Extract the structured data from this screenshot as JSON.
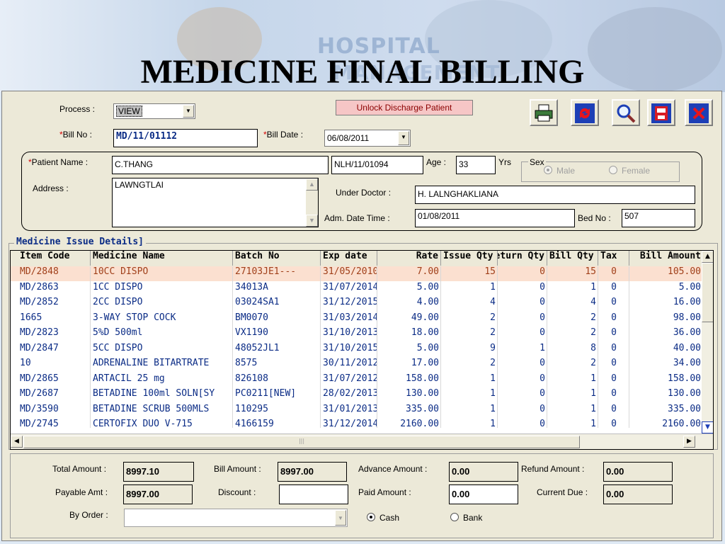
{
  "banner": {
    "title": "MEDICINE FINAL BILLING",
    "watermark_line1": "HOSPITAL",
    "watermark_line2": "MANAGEMENT"
  },
  "form": {
    "process_label": "Process :",
    "process_value": "VIEW",
    "bill_no_label": "Bill No :",
    "bill_no_value": "MD/11/01112",
    "bill_date_label": "Bill Date :",
    "bill_date_value": "06/08/2011",
    "unlock_label": "Unlock Discharge Patient",
    "patient_name_label": "Patient Name :",
    "patient_name_value": "C.THANG",
    "patient_id_value": "NLH/11/01094",
    "age_label": "Age :",
    "age_value": "33",
    "age_unit": "Yrs",
    "sex_label": "Sex",
    "sex_male": "Male",
    "sex_female": "Female",
    "address_label": "Address :",
    "address_value": "LAWNGTLAI",
    "under_doctor_label": "Under Doctor :",
    "under_doctor_value": "H. LALNGHAKLIANA",
    "adm_date_label": "Adm. Date Time :",
    "adm_date_value": "01/08/2011",
    "bed_no_label": "Bed No :",
    "bed_no_value": "507"
  },
  "toolbar": {
    "buttons": [
      "printer-icon",
      "refresh-icon",
      "search-icon",
      "save-icon",
      "close-icon"
    ]
  },
  "grid": {
    "title": "Medicine Issue  Details]",
    "headers": [
      "Item Code",
      "Medicine Name",
      "Batch No",
      "Exp date",
      "Rate",
      "Issue Qty",
      "Return Qty",
      "Bill Qty",
      "Tax",
      "Bill Amount"
    ],
    "rows": [
      [
        "MD/2848",
        "10CC DISPO",
        "27103JE1---",
        "31/05/2010",
        "7.00",
        "15",
        "0",
        "15",
        "0",
        "105.00"
      ],
      [
        "MD/2863",
        "1CC DISPO",
        "34013A",
        "31/07/2014",
        "5.00",
        "1",
        "0",
        "1",
        "0",
        "5.00"
      ],
      [
        "MD/2852",
        "2CC DISPO",
        "03024SA1",
        "31/12/2015",
        "4.00",
        "4",
        "0",
        "4",
        "0",
        "16.00"
      ],
      [
        "1665",
        "3-WAY STOP COCK",
        "BM0070",
        "31/03/2014",
        "49.00",
        "2",
        "0",
        "2",
        "0",
        "98.00"
      ],
      [
        "MD/2823",
        "5%D 500ml",
        "VX1190",
        "31/10/2013",
        "18.00",
        "2",
        "0",
        "2",
        "0",
        "36.00"
      ],
      [
        "MD/2847",
        "5CC DISPO",
        "48052JL1",
        "31/10/2015",
        "5.00",
        "9",
        "1",
        "8",
        "0",
        "40.00"
      ],
      [
        "10",
        "ADRENALINE BITARTRATE",
        "8575",
        "30/11/2012",
        "17.00",
        "2",
        "0",
        "2",
        "0",
        "34.00"
      ],
      [
        "MD/2865",
        "ARTACIL 25 mg",
        "826108",
        "31/07/2012",
        "158.00",
        "1",
        "0",
        "1",
        "0",
        "158.00"
      ],
      [
        "MD/2687",
        "BETADINE 100ml SOLN[SY",
        "PC0211[NEW]",
        "28/02/2013",
        "130.00",
        "1",
        "0",
        "1",
        "0",
        "130.00"
      ],
      [
        "MD/3590",
        "BETADINE SCRUB 500MLS",
        "110295",
        "31/01/2013",
        "335.00",
        "1",
        "0",
        "1",
        "0",
        "335.00"
      ],
      [
        "MD/2745",
        "CERTOFIX DUO V-715",
        "4166159",
        "31/12/2014",
        "2160.00",
        "1",
        "0",
        "1",
        "0",
        "2160.00"
      ]
    ]
  },
  "footer": {
    "total_amount_label": "Total Amount :",
    "total_amount_value": "8997.10",
    "bill_amount_label": "Bill Amount :",
    "bill_amount_value": "8997.00",
    "advance_amount_label": "Advance Amount :",
    "advance_amount_value": "0.00",
    "refund_amount_label": "Refund Amount :",
    "refund_amount_value": "0.00",
    "payable_amt_label": "Payable Amt :",
    "payable_amt_value": "8997.00",
    "discount_label": "Discount :",
    "discount_value": "",
    "paid_amount_label": "Paid Amount :",
    "paid_amount_value": "0.00",
    "current_due_label": "Current Due :",
    "current_due_value": "0.00",
    "by_order_label": "By Order :",
    "by_order_value": "",
    "cash_label": "Cash",
    "bank_label": "Bank"
  }
}
